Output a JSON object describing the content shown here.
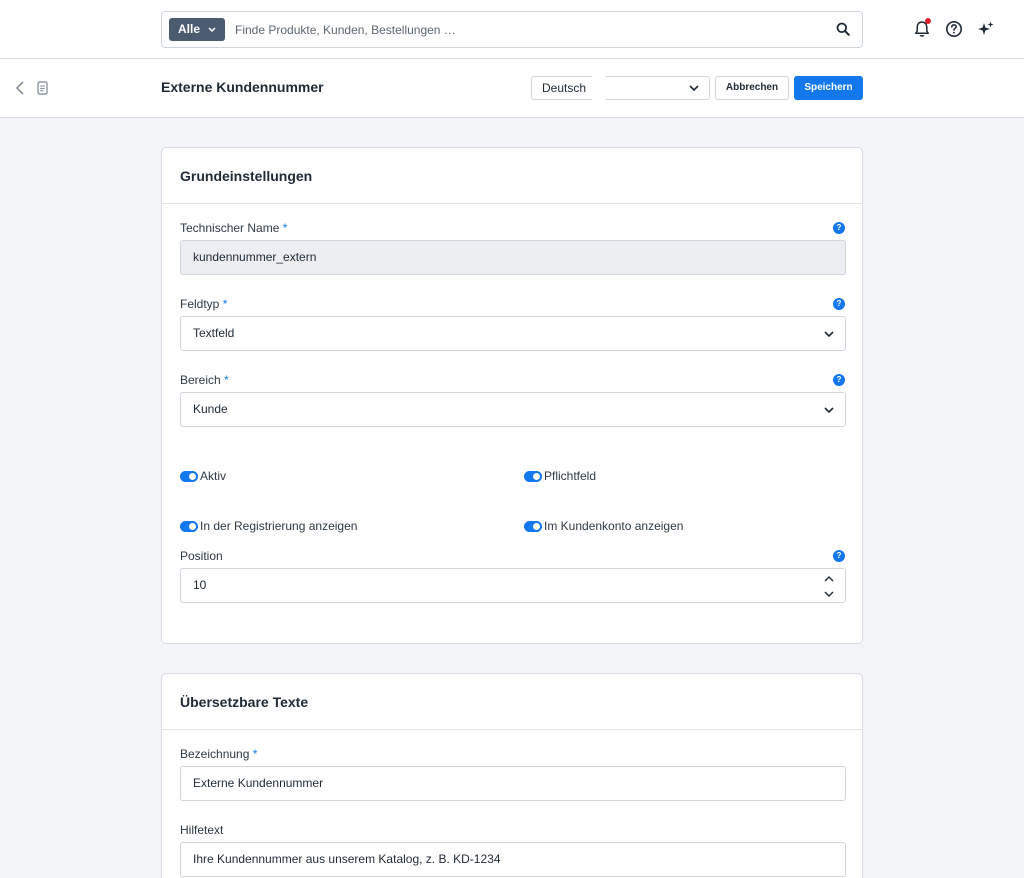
{
  "topbar": {
    "search_type": "Alle",
    "search_placeholder": "Finde Produkte, Kunden, Bestellungen …"
  },
  "actionbar": {
    "title": "Externe Kundennummer",
    "language": "Deutsch",
    "cancel_label": "Abbrechen",
    "save_label": "Speichern"
  },
  "basic": {
    "title": "Grundeinstellungen",
    "technical_name": {
      "label": "Technischer Name",
      "required": "*",
      "value": "kundennummer_extern"
    },
    "field_type": {
      "label": "Feldtyp",
      "required": "*",
      "value": "Textfeld"
    },
    "scope": {
      "label": "Bereich",
      "required": "*",
      "value": "Kunde"
    },
    "toggles": {
      "active": {
        "label": "Aktiv",
        "on": true
      },
      "required": {
        "label": "Pflichtfeld",
        "on": true
      },
      "registration": {
        "label": "In der Registrierung anzeigen",
        "on": true
      },
      "account": {
        "label": "Im Kundenkonto anzeigen",
        "on": true
      }
    },
    "position": {
      "label": "Position",
      "value": "10"
    }
  },
  "translatable": {
    "title": "Übersetzbare Texte",
    "name": {
      "label": "Bezeichnung",
      "required": "*",
      "value": "Externe Kundennummer"
    },
    "help": {
      "label": "Hilfetext",
      "value": "Ihre Kundennummer aus unserem Katalog, z. B. KD-1234"
    }
  },
  "colors": {
    "accent": "#1378ee",
    "notification": "#e0202f"
  },
  "icons": [
    "search-icon",
    "bell-icon",
    "help-circle-icon",
    "sparkle-icon",
    "chevron-left-icon",
    "document-icon",
    "chevron-down-icon",
    "chevron-up-icon",
    "help-icon"
  ]
}
